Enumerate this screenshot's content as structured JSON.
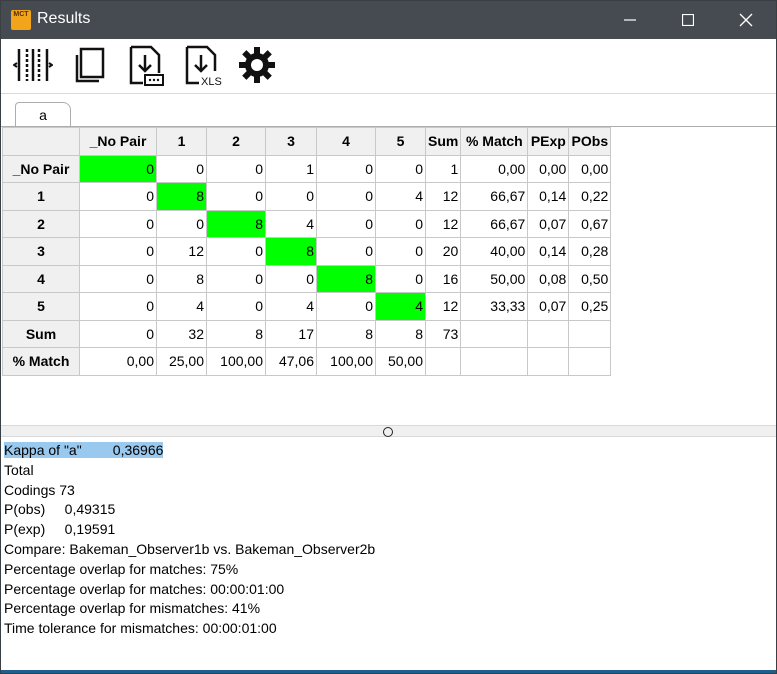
{
  "window": {
    "title": "Results",
    "app_icon_text": "MCT"
  },
  "toolbar": {
    "buttons": [
      {
        "name": "columns-tool-button",
        "icon": "column-resize-icon"
      },
      {
        "name": "copy-button",
        "icon": "copy-icon"
      },
      {
        "name": "export-text-button",
        "icon": "download-text-icon"
      },
      {
        "name": "export-xls-button",
        "icon": "download-xls-icon",
        "label": "XLS"
      },
      {
        "name": "settings-button",
        "icon": "gear-icon"
      }
    ]
  },
  "tabs": [
    {
      "label": "a",
      "active": true
    }
  ],
  "grid": {
    "columns": [
      "_No Pair",
      "1",
      "2",
      "3",
      "4",
      "5",
      "Sum",
      "% Match",
      "PExp",
      "PObs"
    ],
    "rows": [
      {
        "label": "_No Pair",
        "cells": [
          "0",
          "0",
          "0",
          "1",
          "0",
          "0",
          "1",
          "0,00",
          "0,00",
          "0,00"
        ]
      },
      {
        "label": "1",
        "cells": [
          "0",
          "8",
          "0",
          "0",
          "0",
          "4",
          "12",
          "66,67",
          "0,14",
          "0,22"
        ]
      },
      {
        "label": "2",
        "cells": [
          "0",
          "0",
          "8",
          "4",
          "0",
          "0",
          "12",
          "66,67",
          "0,07",
          "0,67"
        ]
      },
      {
        "label": "3",
        "cells": [
          "0",
          "12",
          "0",
          "8",
          "0",
          "0",
          "20",
          "40,00",
          "0,14",
          "0,28"
        ]
      },
      {
        "label": "4",
        "cells": [
          "0",
          "8",
          "0",
          "0",
          "8",
          "0",
          "16",
          "50,00",
          "0,08",
          "0,50"
        ]
      },
      {
        "label": "5",
        "cells": [
          "0",
          "4",
          "0",
          "4",
          "0",
          "4",
          "12",
          "33,33",
          "0,07",
          "0,25"
        ]
      },
      {
        "label": "Sum",
        "cells": [
          "0",
          "32",
          "8",
          "17",
          "8",
          "8",
          "73",
          "",
          "",
          ""
        ]
      },
      {
        "label": "% Match",
        "cells": [
          "0,00",
          "25,00",
          "100,00",
          "47,06",
          "100,00",
          "50,00",
          "",
          "",
          "",
          ""
        ]
      }
    ],
    "highlight_color": "#00ff00"
  },
  "report": {
    "kappa_line": "Kappa of \"a\"        0,36966",
    "lines": [
      "Total",
      "Codings 73",
      "P(obs)     0,49315",
      "P(exp)     0,19591",
      "Compare: Bakeman_Observer1b vs. Bakeman_Observer2b",
      "Percentage overlap for matches: 75%",
      "Percentage overlap for matches: 00:00:01:00",
      "Percentage overlap for mismatches: 41%",
      "Time tolerance for mismatches: 00:00:01:00"
    ]
  }
}
